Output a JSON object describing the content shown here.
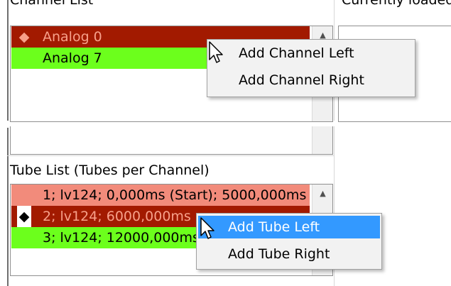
{
  "channel_panel": {
    "title": "Channel List",
    "items": [
      {
        "marker": "◆",
        "label": "Analog 0",
        "bg": "#a21a00",
        "fg": "#f7a08a"
      },
      {
        "marker": "",
        "label": "Analog 7",
        "bg": "#6cff1c",
        "fg": "#000000"
      }
    ],
    "scroll_up": "▲"
  },
  "right_panel": {
    "title": "Currently loaded"
  },
  "channel_menu": {
    "items": [
      "Add Channel Left",
      "Add Channel Right"
    ]
  },
  "tube_panel": {
    "title": "Tube List  (Tubes per Channel)",
    "items": [
      {
        "marker": "",
        "label": "1; lv124; 0,000ms (Start); 5000,000ms",
        "bg": "#f28b7b",
        "fg": "#000000"
      },
      {
        "marker": "◆",
        "label": "2; lv124; 6000,000ms",
        "bg": "#a21a00",
        "fg": "#f7a08a"
      },
      {
        "marker": "",
        "label": "3; lv124; 12000,000ms",
        "bg": "#6cff1c",
        "fg": "#000000"
      }
    ],
    "scroll_up": "▲"
  },
  "tube_menu": {
    "items": [
      "Add Tube Left",
      "Add Tube Right"
    ],
    "highlighted_index": 0
  },
  "colors": {
    "selected_bg": "#a21a00",
    "active_green": "#6cff1c",
    "salmon": "#f28b7b",
    "menu_highlight": "#3399ff"
  }
}
